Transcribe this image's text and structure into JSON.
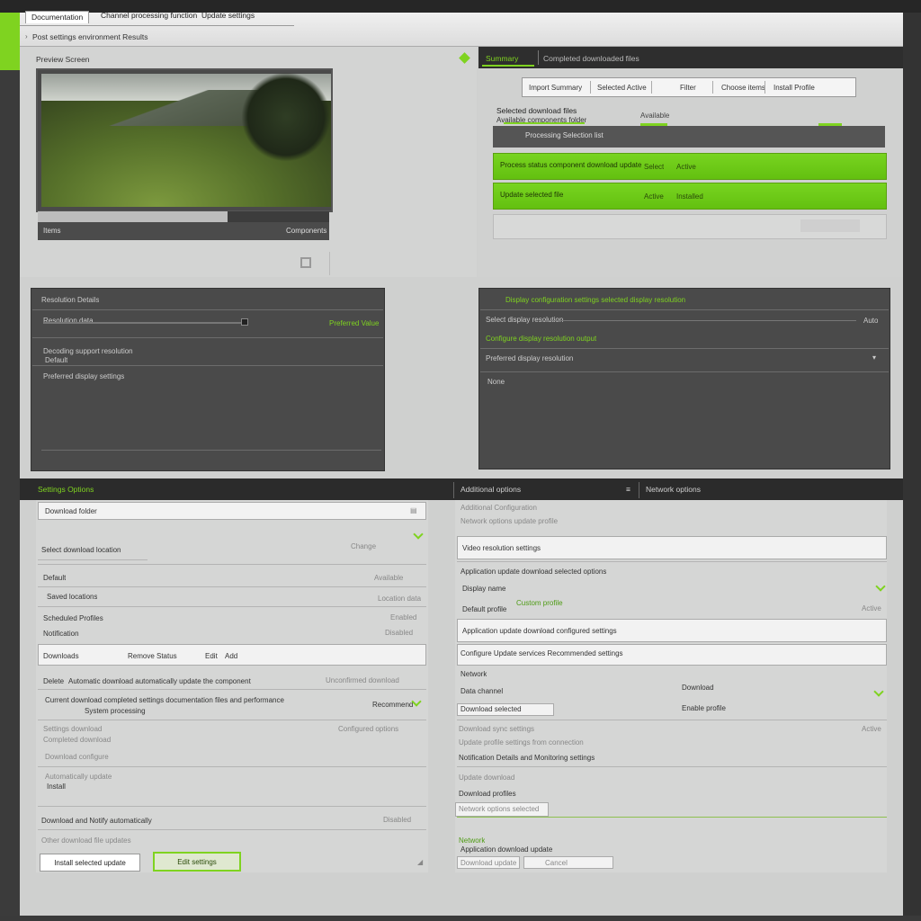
{
  "window": {
    "tabs": [
      "Documentation",
      "Channel processing function",
      "Update settings"
    ],
    "breadcrumb": "Post settings environment Results"
  },
  "preview": {
    "title": "Preview Screen",
    "footer_left": "Items",
    "footer_right": "Components",
    "progress": 0.65
  },
  "results": {
    "tabs": [
      "Summary",
      "Completed downloaded files"
    ],
    "filters": [
      "Import Summary",
      "Selected Active",
      "Filter",
      "Choose items",
      "Install Profile"
    ],
    "heading": "Selected download files",
    "subheading": "Available components folder",
    "right_label": "Available",
    "rows": [
      {
        "label": "Processing Selection list",
        "cells": []
      },
      {
        "label": "Process status component download update",
        "cells": [
          "Select",
          "Active"
        ]
      },
      {
        "label": "Update selected file",
        "cells": [
          "Active",
          "Installed"
        ]
      }
    ]
  },
  "left_dark": {
    "title": "Resolution Details",
    "slider_label": "Resolution data",
    "slider_value": "Preferred Value",
    "line1": "Decoding support resolution",
    "line1b": "Default",
    "line2": "Preferred display settings"
  },
  "right_dark": {
    "title": "Display configuration settings selected display resolution",
    "row1": "Select display resolution",
    "row1_right": "Auto",
    "row2": "Configure display resolution output",
    "row3": "Preferred display resolution",
    "row4": "None"
  },
  "bottom_bar": {
    "left": "Settings Options",
    "mid": "Additional options",
    "right": "Network options"
  },
  "bottom_left": {
    "field1": "Download folder",
    "row1": "Select download location",
    "row1_right": "Change",
    "row2": "Default",
    "row2_right": "Available",
    "row3": "Saved locations",
    "row3_right": "Location data",
    "row4": "Scheduled Profiles",
    "row4_right": "Enabled",
    "row5": "Notification",
    "row5_right": "Disabled",
    "field2_cells": [
      "Downloads",
      "Remove",
      "Status",
      "Edit",
      "Add"
    ],
    "row6": "Delete",
    "row6b": "Automatic download automatically update the component",
    "row6_right": "Unconfirmed download",
    "row7": "Current download completed settings documentation files and performance",
    "row7b": "System processing",
    "row7_right": "Recommend",
    "row8": "Settings download",
    "row8b": "Completed download",
    "row8_right": "Configured options",
    "row9": "Download configure",
    "row10": "Automatically update",
    "row10b": "Install",
    "row11": "Download and Notify automatically",
    "row11_right": "Disabled",
    "row12": "Other download file updates",
    "buttons": {
      "primary": "Install selected update",
      "secondary": "Edit settings"
    }
  },
  "bottom_right": {
    "row0": "Additional Configuration",
    "row0b": "Network options update profile",
    "field1": "Video resolution settings",
    "row1": "Application update download selected options",
    "row2": "Display name",
    "row2_green": "Custom profile",
    "row3": "Default profile",
    "row3_right": "Active",
    "field2": "Application update download configured settings",
    "field3": "Configure Update services Recommended settings",
    "row4": "Network",
    "row5": "Data channel",
    "row5_green": "Download",
    "row6": "Download selected",
    "row6_right": "Enable profile",
    "row7": "Download sync settings",
    "row7b": "Update profile settings from connection",
    "row7_right": "Active",
    "row8": "Notification Details and Monitoring settings",
    "row9": "Update download",
    "row10": "Download profiles",
    "row11": "Network options selected",
    "row12": "Network",
    "row12b": "Application download update",
    "field4_cells": [
      "Download update",
      "Cancel"
    ]
  }
}
